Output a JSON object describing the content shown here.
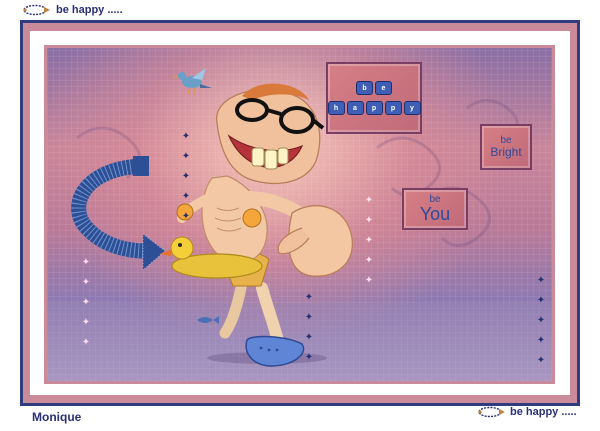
{
  "header": {
    "badge_text": "be happy ....."
  },
  "footer": {
    "signature": "Monique",
    "badge_text": "be happy ....."
  },
  "scene": {
    "tags": [
      {
        "name": "tag-be-happy",
        "line1": "be",
        "line2": "happy"
      },
      {
        "name": "tag-be-bright",
        "line1": "be",
        "line2": "Bright"
      },
      {
        "name": "tag-be-you",
        "line1": "be",
        "line2": "You"
      }
    ]
  },
  "colors": {
    "frame_navy": "#2f3d80",
    "frame_pink": "#c98b9a",
    "text_navy": "#2a2f78",
    "tag_pink": "#d67f86",
    "tag_text_blue": "#2f4a9a"
  },
  "icons": [
    "swirl-arrow-icon",
    "bird-icon",
    "curved-arrow-icon",
    "star-icon",
    "duck-icon",
    "cartoon-man-figure"
  ]
}
